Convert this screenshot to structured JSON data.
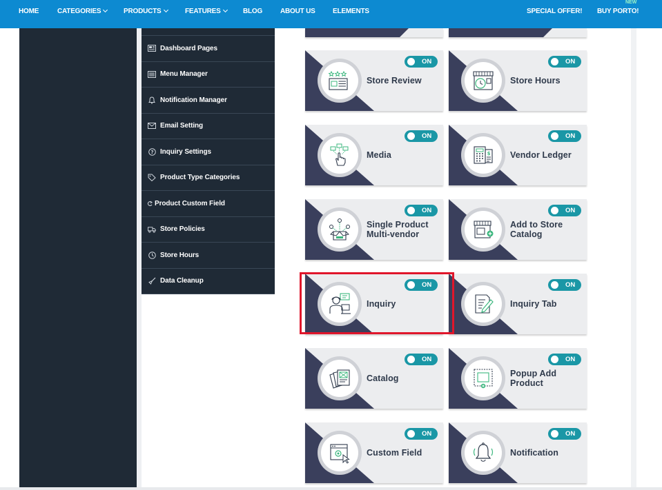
{
  "nav": {
    "home": "HOME",
    "categories": "CATEGORIES",
    "products": "PRODUCTS",
    "features": "FEATURES",
    "blog": "BLOG",
    "about": "ABOUT US",
    "elements": "ELEMENTS",
    "special_offer": "SPECIAL OFFER!",
    "buy": "BUY PORTO!",
    "new_badge": "NEW"
  },
  "menu": {
    "items": [
      {
        "label": "Dashboard Pages",
        "icon": "dashboard-icon"
      },
      {
        "label": "Menu Manager",
        "icon": "menu-icon"
      },
      {
        "label": "Notification Manager",
        "icon": "bell-icon"
      },
      {
        "label": "Email Setting",
        "icon": "envelope-icon"
      },
      {
        "label": "Inquiry Settings",
        "icon": "question-icon"
      },
      {
        "label": "Product Type Categories",
        "icon": "tags-icon"
      },
      {
        "label": "Product Custom Field",
        "icon": "sync-icon"
      },
      {
        "label": "Store Policies",
        "icon": "truck-icon"
      },
      {
        "label": "Store Hours",
        "icon": "clock-icon"
      },
      {
        "label": "Data Cleanup",
        "icon": "broom-icon"
      }
    ]
  },
  "modules": {
    "toggle_label": "ON",
    "items": [
      {
        "label": "Store Review",
        "icon": "store-review-icon"
      },
      {
        "label": "Store Hours",
        "icon": "store-hours-icon"
      },
      {
        "label": "Media",
        "icon": "media-icon"
      },
      {
        "label": "Vendor Ledger",
        "icon": "vendor-ledger-icon"
      },
      {
        "label": "Single Product Multi-vendor",
        "icon": "multi-vendor-icon"
      },
      {
        "label": "Add to Store Catalog",
        "icon": "store-catalog-icon"
      },
      {
        "label": "Inquiry",
        "icon": "inquiry-icon"
      },
      {
        "label": "Inquiry Tab",
        "icon": "inquiry-tab-icon"
      },
      {
        "label": "Catalog",
        "icon": "catalog-icon"
      },
      {
        "label": "Popup Add Product",
        "icon": "popup-add-product-icon"
      },
      {
        "label": "Custom Field",
        "icon": "custom-field-icon"
      },
      {
        "label": "Notification",
        "icon": "notification-icon"
      }
    ]
  },
  "colors": {
    "nav_bg": "#0d8ad1",
    "sidebar_bg": "#1f2a36",
    "card_dark": "#3a3f5c",
    "toggle_on": "#1a97a6",
    "icon_green": "#3bb77e",
    "highlight": "#e0162b"
  }
}
